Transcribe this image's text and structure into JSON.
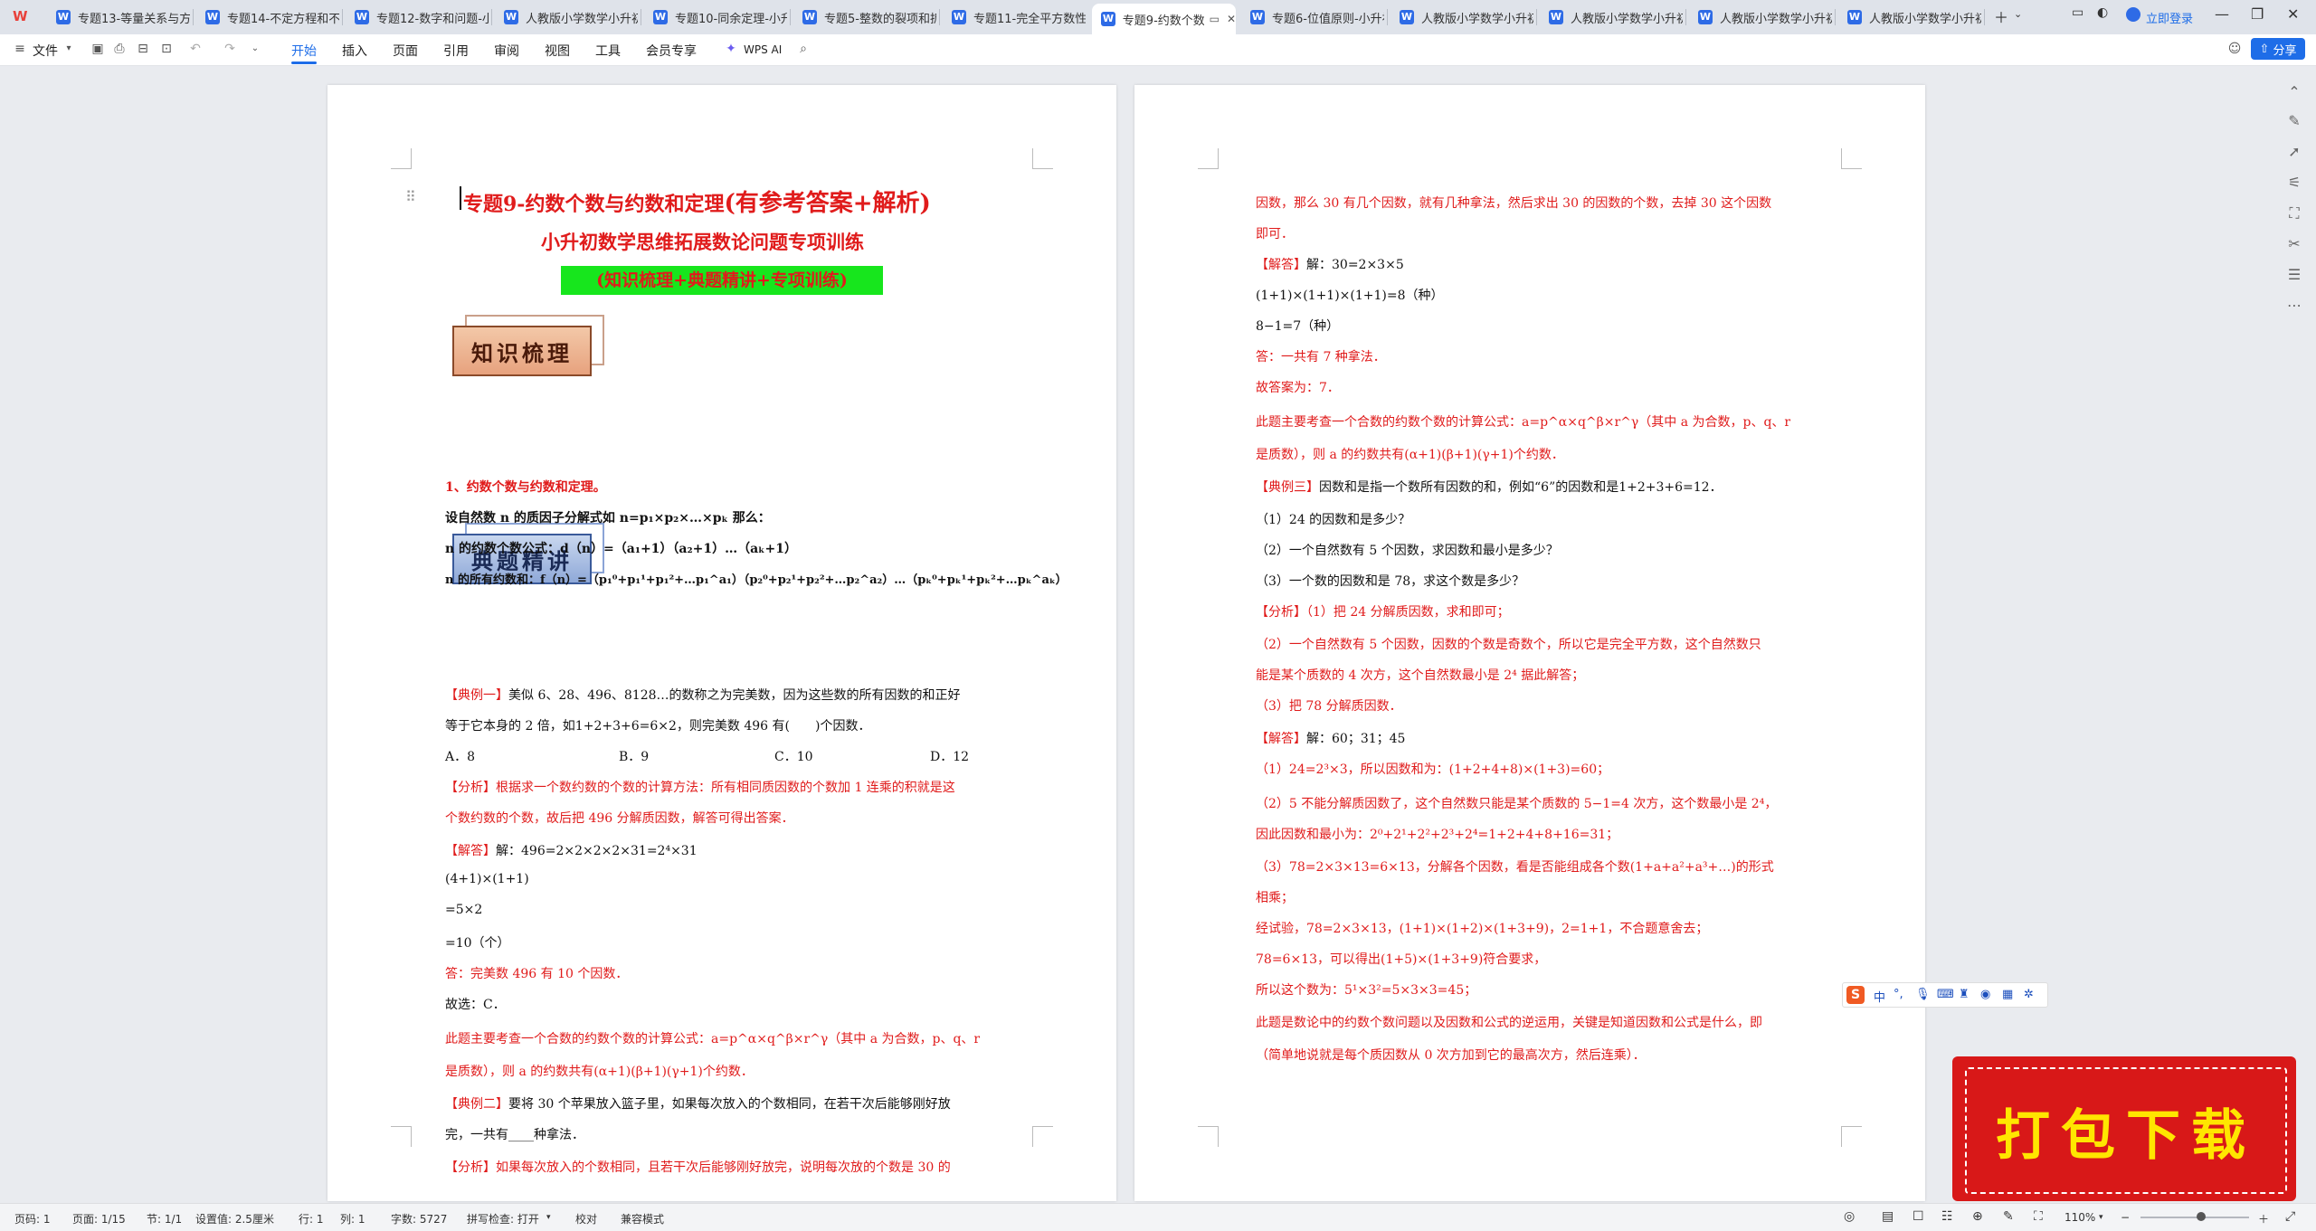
{
  "tabs": [
    {
      "label": "专题13-等量关系与方"
    },
    {
      "label": "专题14-不定方程和不"
    },
    {
      "label": "专题12-数字和问题-小"
    },
    {
      "label": "人教版小学数学小升初"
    },
    {
      "label": "专题10-同余定理-小升"
    },
    {
      "label": "专题5-整数的裂项和拆"
    },
    {
      "label": "专题11-完全平方数性"
    },
    {
      "label": "专题9-约数个数"
    },
    {
      "label": "专题6-位值原则-小升初"
    },
    {
      "label": "人教版小学数学小升初"
    },
    {
      "label": "人教版小学数学小升初"
    },
    {
      "label": "人教版小学数学小升初"
    },
    {
      "label": "人教版小学数学小升初"
    }
  ],
  "login_label": "立即登录",
  "share_label": "分享",
  "menu": {
    "file": "文件",
    "items": [
      "开始",
      "插入",
      "页面",
      "引用",
      "审阅",
      "视图",
      "工具",
      "会员专享"
    ],
    "wps_ai": "WPS AI"
  },
  "page1": {
    "title": "专题9-约数个数与约数和定理",
    "title_suffix": "(有参考答案+解析)",
    "subtitle": "小升初数学思维拓展数论问题专项训练",
    "green_box": "(知识梳理+典题精讲+专项训练)",
    "banner1": "知识梳理",
    "banner2": "典题精讲",
    "lines": [
      "1、约数个数与约数和定理。",
      "设自然数 n 的质因子分解式如 n=p₁×p₂×…×pₖ 那么：",
      "n 的约数个数公式：d（n）=（a₁+1）（a₂+1）…（aₖ+1）",
      "n 的所有约数和：f（n）=（p₁⁰+p₁¹+p₁²+…p₁^a₁）（p₂⁰+p₂¹+p₂²+…p₂^a₂）…（pₖ⁰+pₖ¹+pₖ²+…pₖ^aₖ）",
      "【典例一】美似 6、28、496、8128…的数称之为完美数，因为这些数的所有因数的和正好",
      "等于它本身的 2 倍，如1+2+3+6=6×2，则完美数 496 有(　　)个因数．",
      "A．8",
      "B．9",
      "C．10",
      "D．12",
      "【分析】根据求一个数约数的个数的计算方法：所有相同质因数的个数加 1 连乘的积就是这",
      "个数约数的个数，故后把 496 分解质因数，解答可得出答案．",
      "【解答】解：496=2×2×2×2×31=2⁴×31",
      "(4+1)×(1+1)",
      "=5×2",
      "=10（个）",
      "答：完美数 496 有 10 个因数．",
      "故选：C．",
      "此题主要考查一个合数的约数个数的计算公式：a=p^α×q^β×r^γ（其中 a 为合数，p、q、r",
      "是质数），则 a 的约数共有(α+1)(β+1)(γ+1)个约数．",
      "【典例二】要将 30 个苹果放入篮子里，如果每次放入的个数相同，在若干次后能够刚好放",
      "完，一共有____种拿法．",
      "【分析】如果每次放入的个数相同，且若干次后能够刚好放完，说明每次放的个数是 30 的"
    ]
  },
  "page2": {
    "lines": [
      "因数，那么 30 有几个因数，就有几种拿法，然后求出 30 的因数的个数，去掉 30 这个因数",
      "即可．",
      "【解答】解：30=2×3×5",
      "(1+1)×(1+1)×(1+1)=8（种）",
      "8−1=7（种）",
      "答：一共有 7 种拿法．",
      "故答案为：7．",
      "此题主要考查一个合数的约数个数的计算公式：a=p^α×q^β×r^γ（其中 a 为合数，p、q、r",
      "是质数），则 a 的约数共有(α+1)(β+1)(γ+1)个约数．",
      "【典例三】因数和是指一个数所有因数的和，例如“6”的因数和是1+2+3+6=12．",
      "（1）24 的因数和是多少？",
      "（2）一个自然数有 5 个因数，求因数和最小是多少？",
      "（3）一个数的因数和是 78，求这个数是多少？",
      "【分析】（1）把 24 分解质因数，求和即可；",
      "（2）一个自然数有 5 个因数，因数的个数是奇数个，所以它是完全平方数，这个自然数只",
      "能是某个质数的 4 次方，这个自然数最小是 2⁴ 据此解答；",
      "（3）把 78 分解质因数．",
      "【解答】解：60；31；45",
      "（1）24=2³×3，所以因数和为：(1+2+4+8)×(1+3)=60；",
      "（2）5 不能分解质因数了，这个自然数只能是某个质数的 5−1=4 次方，这个数最小是 2⁴，",
      "因此因数和最小为：2⁰+2¹+2²+2³+2⁴=1+2+4+8+16=31；",
      "（3）78=2×3×13=6×13，分解各个因数，看是否能组成各个数(1+a+a²+a³+…)的形式",
      "相乘；",
      "经试验，78=2×3×13，(1+1)×(1+2)×(1+3+9)，2=1+1，不合题意舍去；",
      "78=6×13，可以得出(1+5)×(1+3+9)符合要求，",
      "所以这个数为：5¹×3²=5×3×3=45；",
      "此题是数论中的约数个数问题以及因数和公式的逆运用，关键是知道因数和公式是什么，即",
      "（简单地说就是每个质因数从 0 次方加到它的最高次方，然后连乘）．"
    ]
  },
  "ime": {
    "mode": "中",
    "punct": "°,"
  },
  "download_label": "打包下载",
  "status": {
    "page_code": "页码: 1",
    "page": "页面: 1/15",
    "section": "节: 1/1",
    "setting": "设置值: 2.5厘米",
    "row": "行: 1",
    "col": "列: 1",
    "words": "字数: 5727",
    "spell": "拼写检查: 打开",
    "proof": "校对",
    "compat": "兼容模式",
    "zoom": "110%"
  }
}
